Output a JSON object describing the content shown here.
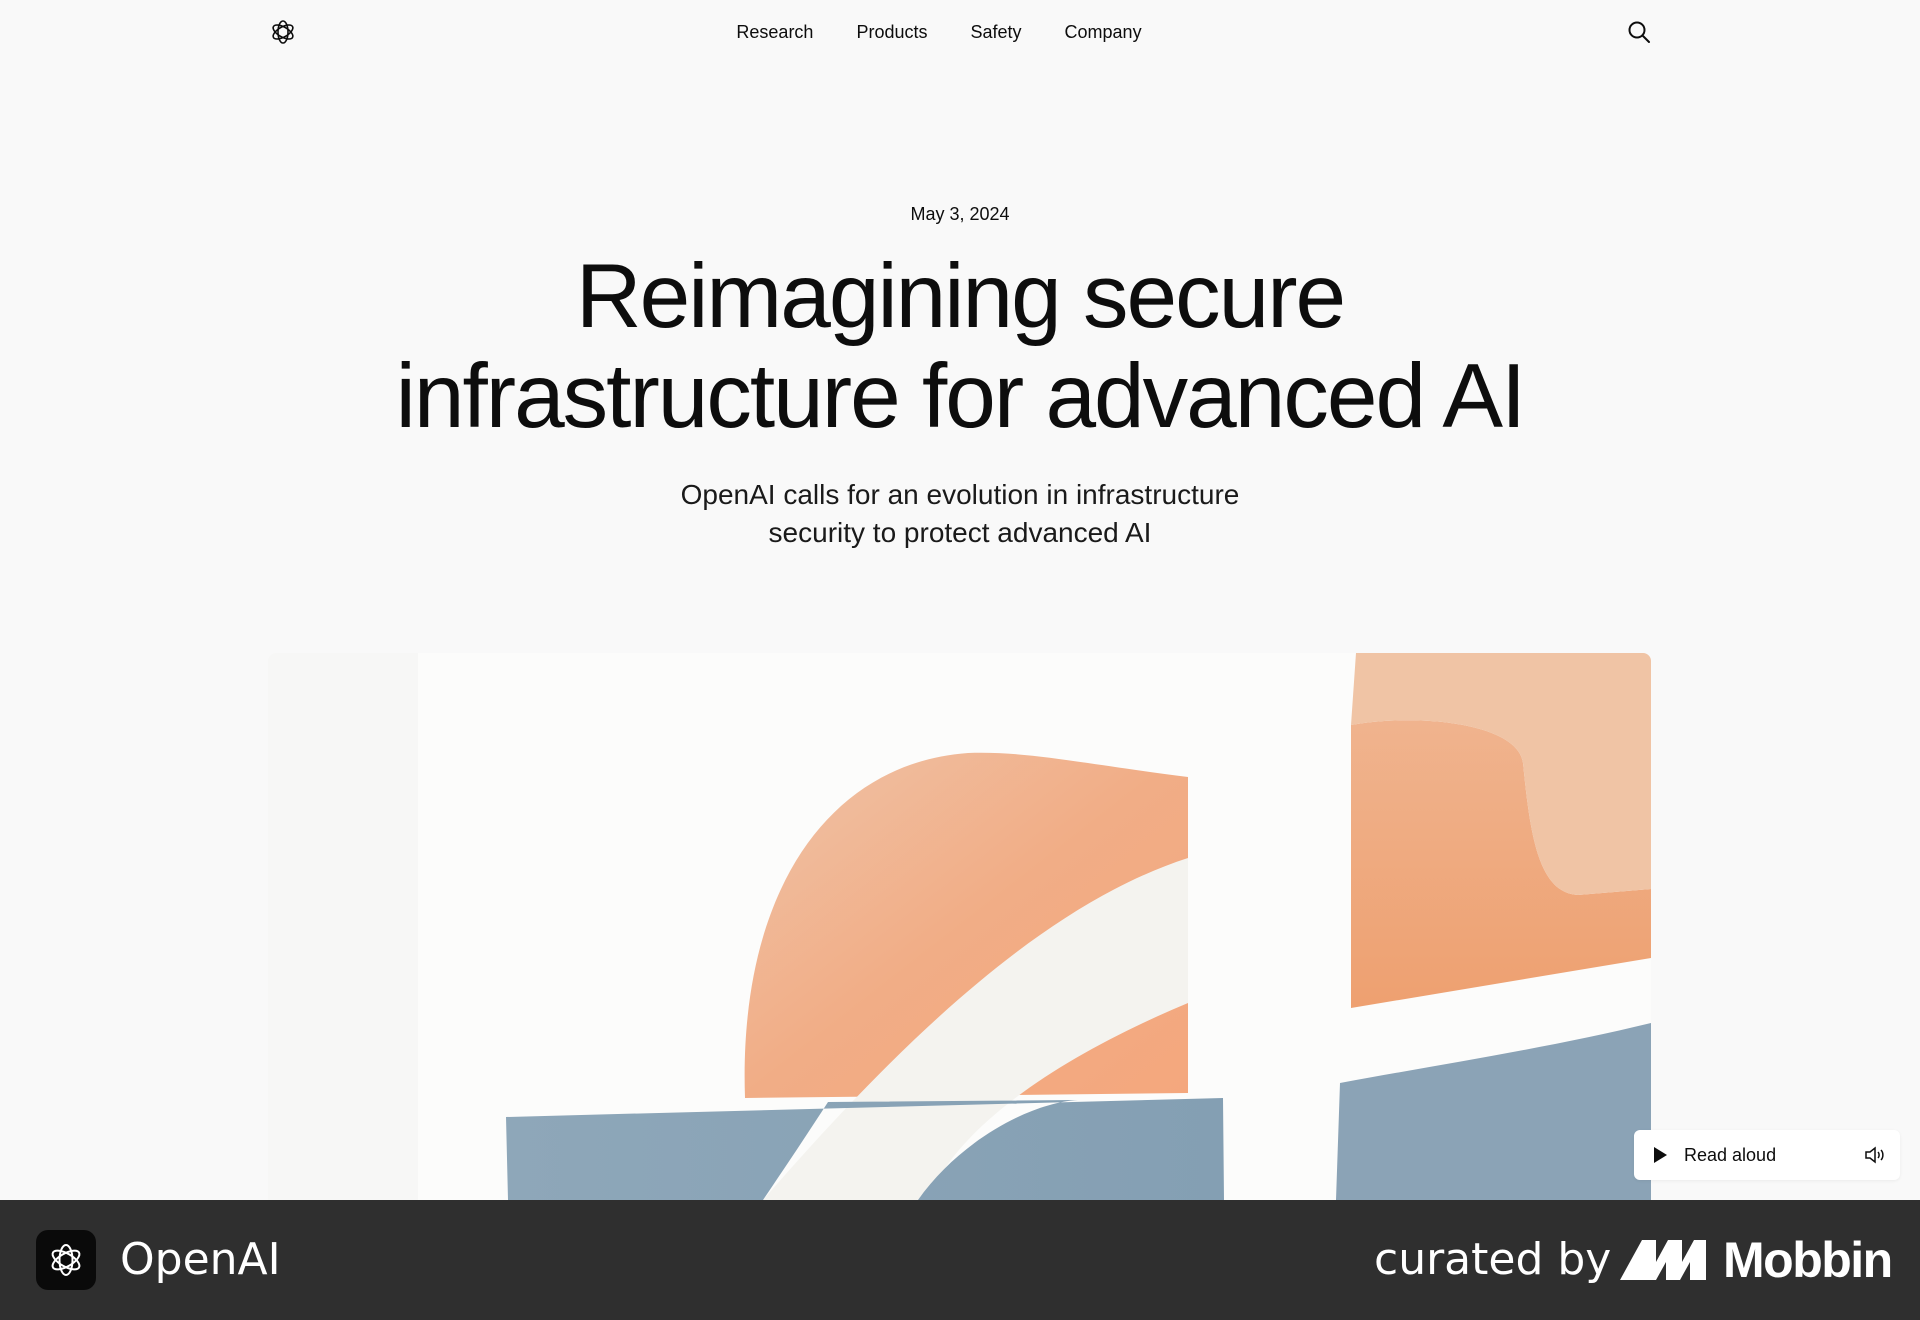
{
  "nav": {
    "logo_icon": "openai-logo-icon",
    "links": [
      "Research",
      "Products",
      "Safety",
      "Company"
    ],
    "search_icon": "search-icon"
  },
  "article": {
    "date": "May 3, 2024",
    "title_lines": [
      "Reimagining secure",
      "infrastructure for advanced AI"
    ],
    "subtitle_lines": [
      "OpenAI calls for an evolution in infrastructure",
      "security to protect advanced AI"
    ]
  },
  "hero_art": {
    "description_icon": "abstract-artwork",
    "colors": {
      "orange": "#f2a77f",
      "blue": "#8aa3b6",
      "cream": "#f5f4f1",
      "bg": "#fcfcfb"
    }
  },
  "read_aloud": {
    "label": "Read aloud",
    "play_icon": "play-icon",
    "volume_icon": "speaker-icon"
  },
  "footer": {
    "app_name": "OpenAI",
    "curated_by": "curated by",
    "brand": "Mobbin",
    "colors": {
      "bar": "#2f2f2f"
    }
  }
}
